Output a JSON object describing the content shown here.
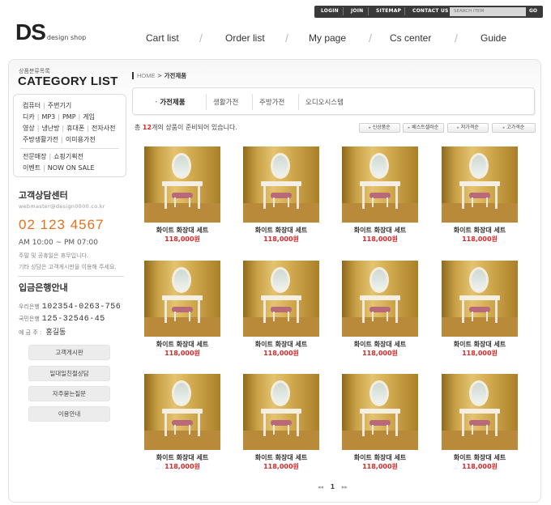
{
  "topbar": {
    "links": [
      "LOGIN",
      "JOIN",
      "SITEMAP",
      "CONTACT US"
    ],
    "search_placeholder": "SEARCH ITEM",
    "search_button": "GO"
  },
  "logo": {
    "mark": "DS",
    "sub": "design shop"
  },
  "gnav": [
    "Cart list",
    "Order list",
    "My page",
    "Cs center",
    "Guide"
  ],
  "sidebar": {
    "small_title": "상품분류목록",
    "title": "CATEGORY LIST",
    "category_lines": [
      [
        "컴퓨터",
        "주변기기"
      ],
      [
        "디카",
        "MP3",
        "PMP",
        "게임"
      ],
      [
        "영상",
        "냉난방",
        "휴대폰",
        "전자사전"
      ],
      [
        "주방생활가전",
        "이미용가전"
      ],
      [
        "전문매장",
        "쇼핑기획전"
      ],
      [
        "이벤트",
        "NOW ON SALE"
      ]
    ],
    "cs_title": "고객상담센터",
    "cs_email": "webmaster@design0000.co.kr",
    "cs_phone": "02 123 4567",
    "cs_hours": "AM 10:00 ~ PM 07:00",
    "cs_note1": "주말 및 공휴일은 휴무입니다.",
    "cs_note2": "기타 상담은 고객게시판을 이용해 주세요.",
    "bank_title": "입금은행안내",
    "bank_rows": [
      {
        "label": "우리은행",
        "value": "102354-0263-756"
      },
      {
        "label": "국민은행",
        "value": "125-32546-45"
      }
    ],
    "holder_label": "예 금 주 :",
    "holder_name": "홍길동",
    "buttons": [
      "고객게시판",
      "일대일친절상담",
      "자주묻는질문",
      "이용안내"
    ]
  },
  "breadcrumb": {
    "home": "HOME",
    "sep": ">",
    "current": "가전제품"
  },
  "tabs": [
    "가전제품",
    "생활가전",
    "주방가전",
    "오디오시스템"
  ],
  "count": {
    "prefix": "총",
    "num": "12",
    "suffix": "개의 상품이 준비되어 있습니다."
  },
  "sort_buttons": [
    "신상품순",
    "베스트셀러순",
    "저가격순",
    "고가격순"
  ],
  "product": {
    "name": "화이트 화장대 세트",
    "price": "118,000원"
  },
  "pager": {
    "prev": "◂◂",
    "page": "1",
    "next": "▸▸"
  }
}
